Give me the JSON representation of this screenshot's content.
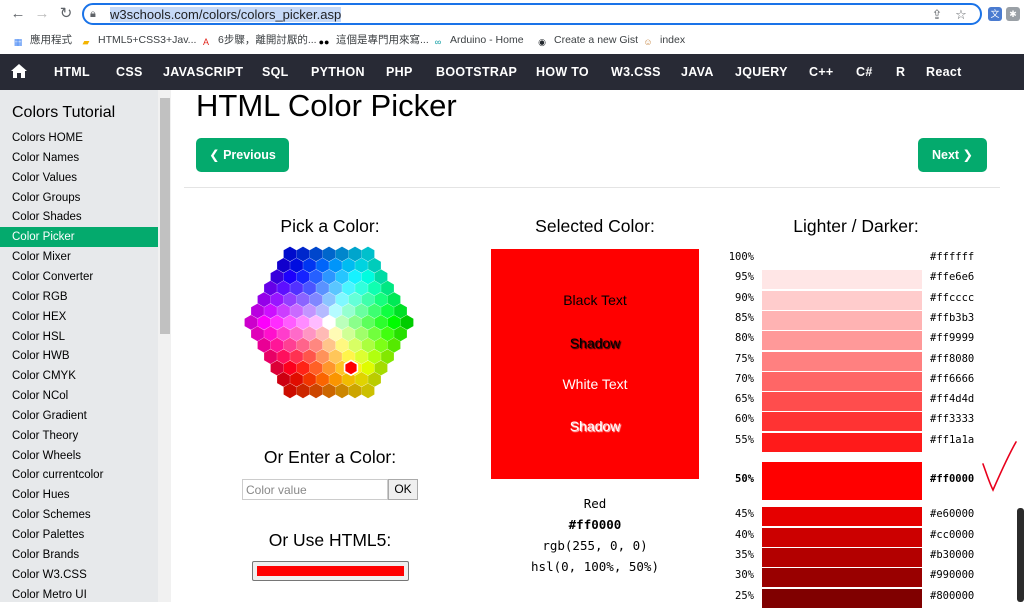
{
  "browser": {
    "url_host": "w3schools.com",
    "url_path": "/colors/colors_picker.asp",
    "bookmarks": [
      {
        "label": "應用程式",
        "icon": "apps-grid-icon",
        "color": "#4285f4"
      },
      {
        "label": "HTML5+CSS3+Jav...",
        "icon": "folder-icon",
        "color": "#f4b400"
      },
      {
        "label": "6步驟，離開討厭的...",
        "icon": "adobe-icon",
        "color": "#e1251b"
      },
      {
        "label": "這個是專門用來寫...",
        "icon": "medium-icon",
        "color": "#000000"
      },
      {
        "label": "Arduino - Home",
        "icon": "arduino-icon",
        "color": "#00979d"
      },
      {
        "label": "Create a new Gist",
        "icon": "github-icon",
        "color": "#24292e"
      },
      {
        "label": "index",
        "icon": "avatar-icon",
        "color": "#c68642"
      }
    ]
  },
  "topnav": {
    "items": [
      "HTML",
      "CSS",
      "JAVASCRIPT",
      "SQL",
      "PYTHON",
      "PHP",
      "BOOTSTRAP",
      "HOW TO",
      "W3.CSS",
      "JAVA",
      "JQUERY",
      "C++",
      "C#",
      "R",
      "React"
    ]
  },
  "sidebar": {
    "title": "Colors Tutorial",
    "active_index": 5,
    "items": [
      "Colors HOME",
      "Color Names",
      "Color Values",
      "Color Groups",
      "Color Shades",
      "Color Picker",
      "Color Mixer",
      "Color Converter",
      "Color RGB",
      "Color HEX",
      "Color HSL",
      "Color HWB",
      "Color CMYK",
      "Color NCol",
      "Color Gradient",
      "Color Theory",
      "Color Wheels",
      "Color currentcolor",
      "Color Hues",
      "Color Schemes",
      "Color Palettes",
      "Color Brands",
      "Color W3.CSS",
      "Color Metro UI"
    ]
  },
  "main": {
    "title": "HTML Color Picker",
    "prev_label": "❮ Previous",
    "next_label": "Next ❯",
    "pick_heading": "Pick a Color:",
    "enter_heading": "Or Enter a Color:",
    "input_placeholder": "Color value",
    "ok_label": "OK",
    "html5_heading": "Or Use HTML5:",
    "html5_value": "#ff0000"
  },
  "selected": {
    "heading": "Selected Color:",
    "color": "#ff0000",
    "black_text": "Black Text",
    "shadow_1": "Shadow",
    "white_text": "White Text",
    "shadow_2": "Shadow",
    "name": "Red",
    "hex": "#ff0000",
    "rgb": "rgb(255, 0, 0)",
    "hsl": "hsl(0, 100%, 50%)"
  },
  "shades": {
    "heading": "Lighter / Darker:",
    "rows": [
      {
        "pct": "100%",
        "hex": "#ffffff"
      },
      {
        "pct": "95%",
        "hex": "#ffe6e6"
      },
      {
        "pct": "90%",
        "hex": "#ffcccc"
      },
      {
        "pct": "85%",
        "hex": "#ffb3b3"
      },
      {
        "pct": "80%",
        "hex": "#ff9999"
      },
      {
        "pct": "75%",
        "hex": "#ff8080"
      },
      {
        "pct": "70%",
        "hex": "#ff6666"
      },
      {
        "pct": "65%",
        "hex": "#ff4d4d"
      },
      {
        "pct": "60%",
        "hex": "#ff3333"
      },
      {
        "pct": "55%",
        "hex": "#ff1a1a"
      },
      {
        "pct": "50%",
        "hex": "#ff0000",
        "current": true
      },
      {
        "pct": "45%",
        "hex": "#e60000"
      },
      {
        "pct": "40%",
        "hex": "#cc0000"
      },
      {
        "pct": "35%",
        "hex": "#b30000"
      },
      {
        "pct": "30%",
        "hex": "#990000"
      },
      {
        "pct": "25%",
        "hex": "#800000"
      }
    ]
  },
  "colors": {
    "accent": "#04aa6d",
    "nav_bg": "#282a35",
    "sidebar_bg": "#e7e9eb",
    "annotation": "#e8001c"
  }
}
